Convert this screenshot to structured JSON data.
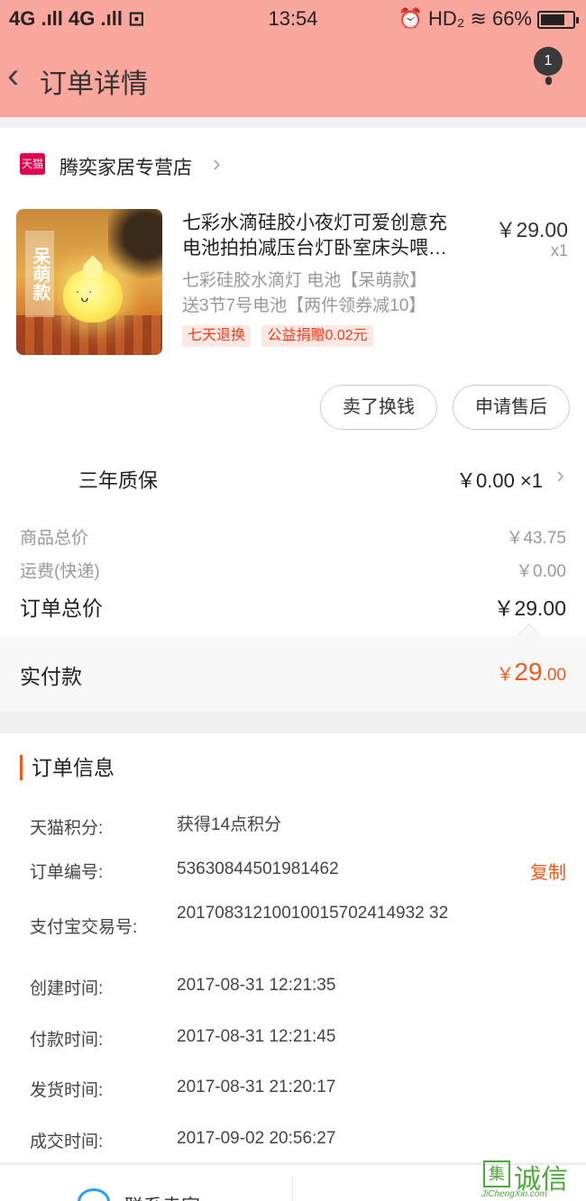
{
  "status_bar": {
    "signal_left": "4G .ıll 4G .ıll ⊡",
    "time": "13:54",
    "right": "⏰ HD₂ ≋ 66%",
    "battery_pct": 66
  },
  "nav": {
    "back_icon": "‹",
    "title": "订单详情",
    "badge": "1",
    "more_icon": "more-vertical-icon"
  },
  "store": {
    "tmall_badge": "天猫",
    "name": "腾奕家居专营店",
    "chevron": "›"
  },
  "product": {
    "thumb_tag": "呆萌款",
    "title_line1": "七彩水滴硅胶小夜灯可爱创意充",
    "title_line2": "电池拍拍减压台灯卧室床头喂…",
    "price": "￥29.00",
    "qty": "x1",
    "sku_line1": "七彩硅胶水滴灯 电池【呆萌款】",
    "sku_line2": "送3节7号电池【两件领券减10】",
    "tags": [
      "七天退换",
      "公益捐赠0.02元"
    ]
  },
  "actions": {
    "sell": "卖了换钱",
    "after_sale": "申请售后"
  },
  "warranty": {
    "label": "三年质保",
    "price": "￥0.00 ×1",
    "chevron": "›"
  },
  "totals": {
    "goods_label": "商品总价",
    "goods_value": "￥43.75",
    "shipping_label": "运费(快递)",
    "shipping_value": "￥0.00",
    "order_label": "订单总价",
    "order_value": "￥29.00"
  },
  "paid": {
    "label": "实付款",
    "currency": "￥",
    "integer": "29",
    "decimal": ".00"
  },
  "info": {
    "title": "订单信息",
    "copy": "复制",
    "rows": [
      {
        "k": "天猫积分:",
        "v": "获得14点积分"
      },
      {
        "k": "订单编号:",
        "v": "53630844501981462"
      },
      {
        "k": "支付宝交易号:",
        "v": "20170831210010015702414932 32"
      },
      {
        "k": "创建时间:",
        "v": "2017-08-31 12:21:35"
      },
      {
        "k": "付款时间:",
        "v": "2017-08-31 12:21:45"
      },
      {
        "k": "发货时间:",
        "v": "2017-08-31 21:20:17"
      },
      {
        "k": "成交时间:",
        "v": "2017-09-02 20:56:27"
      }
    ]
  },
  "bottom": {
    "contact": "联系卖家"
  },
  "watermark": {
    "logo": "集",
    "text": "诚信",
    "url": "JiChengXin.com"
  },
  "colors": {
    "header_bg": "#f9a79c",
    "accent": "#f25a1c",
    "tmall_red": "#e5004f"
  }
}
